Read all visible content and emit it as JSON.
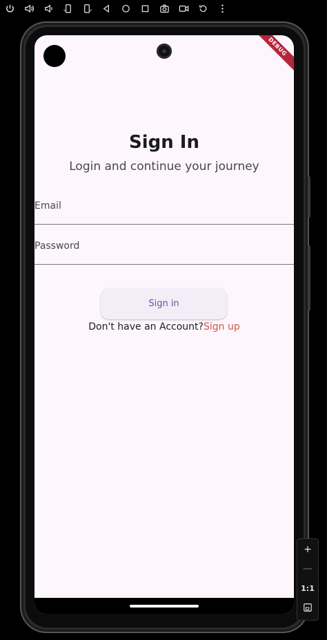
{
  "toolbar": {
    "icons": [
      "power-icon",
      "volume-up-icon",
      "volume-down-icon",
      "rotate-left-icon",
      "rotate-right-icon",
      "back-icon",
      "home-icon",
      "overview-icon",
      "camera-icon",
      "video-icon",
      "replay-icon",
      "more-icon"
    ]
  },
  "screen": {
    "debug_banner": "DEBUG",
    "title": "Sign In",
    "subtitle": "Login and continue your journey",
    "email_label": "Email",
    "password_label": "Password",
    "signin_button": "Sign in",
    "no_account_text": "Don't have an Account?",
    "signup_link": "Sign up"
  },
  "zoom": {
    "zoom_in": "+",
    "zoom_out": "—",
    "ratio": "1:1"
  },
  "colors": {
    "background": "#fdf7fd",
    "primary": "#6750a4",
    "link": "#c9574b",
    "button_bg": "#f3edf7"
  }
}
